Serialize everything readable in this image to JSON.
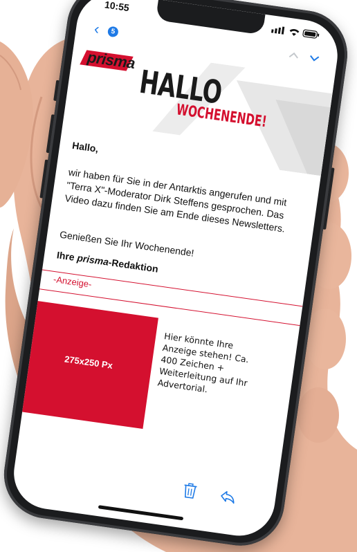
{
  "status_bar": {
    "time": "10:55"
  },
  "mail_nav": {
    "back_icon": "chevron-left-icon",
    "unread_count": "5",
    "prev_icon": "chevron-up-icon",
    "next_icon": "chevron-down-icon"
  },
  "newsletter": {
    "logo": "prisma",
    "headline": "HALLO",
    "subheadline": "WOCHENENDE!",
    "greeting": "Hallo,",
    "body": "wir haben für Sie in der Antarktis angerufen und mit \"Terra X\"-Moderator Dirk Steffens gesprochen. Das Video dazu finden Sie am Ende dieses Newsletters.",
    "closing": "Genießen Sie Ihr Wochenende!",
    "signature_prefix": "Ihre ",
    "signature_brand": "prisma",
    "signature_suffix": "-Redaktion"
  },
  "ad": {
    "label": "-Anzeige-",
    "placeholder_size": "275x250 Px",
    "text": "Hier könnte Ihre Anzeige stehen! Ca. 400 Zeichen + Weiterleitung auf Ihr Advertorial."
  },
  "toolbar": {
    "trash_icon": "trash-icon",
    "reply_icon": "reply-icon"
  },
  "colors": {
    "brand_red": "#d4102f",
    "ios_blue": "#1e7ae6"
  }
}
